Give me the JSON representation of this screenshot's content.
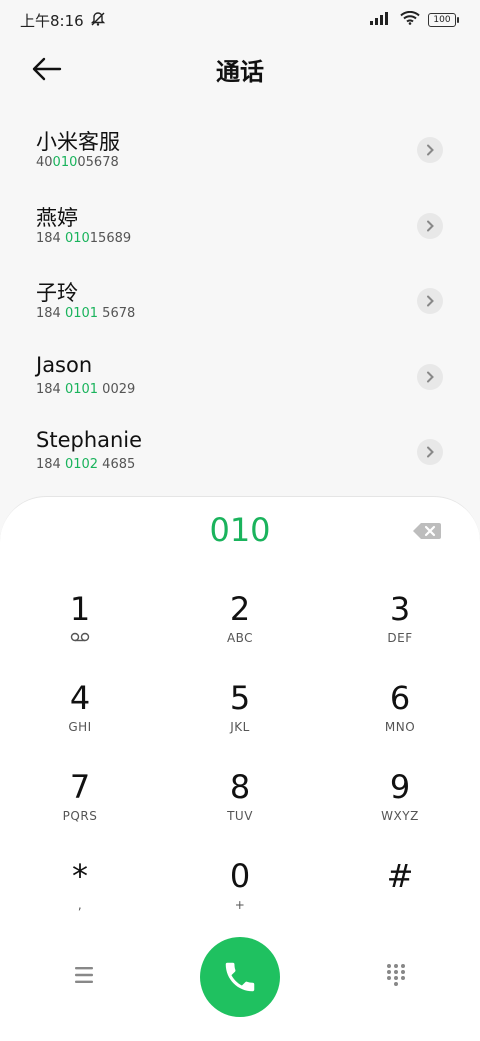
{
  "status": {
    "time": "上午8:16",
    "battery": "100"
  },
  "header": {
    "title": "通话"
  },
  "contacts": [
    {
      "name": "小米客服",
      "num_pre": "40",
      "num_hl": "010",
      "num_post": "05678"
    },
    {
      "name": "燕婷",
      "num_pre": "184 ",
      "num_hl": "010",
      "num_post": "15689"
    },
    {
      "name": "子玲",
      "num_pre": "184 ",
      "num_hl": "0101",
      "num_post": " 5678"
    },
    {
      "name": "Jason",
      "num_pre": "184 ",
      "num_hl": "0101",
      "num_post": " 0029"
    },
    {
      "name": "Stephanie",
      "num_pre": "184 ",
      "num_hl": "0102",
      "num_post": " 4685"
    }
  ],
  "dialer": {
    "typed": "010",
    "keys": [
      {
        "digit": "1",
        "letters": ""
      },
      {
        "digit": "2",
        "letters": "ABC"
      },
      {
        "digit": "3",
        "letters": "DEF"
      },
      {
        "digit": "4",
        "letters": "GHI"
      },
      {
        "digit": "5",
        "letters": "JKL"
      },
      {
        "digit": "6",
        "letters": "MNO"
      },
      {
        "digit": "7",
        "letters": "PQRS"
      },
      {
        "digit": "8",
        "letters": "TUV"
      },
      {
        "digit": "9",
        "letters": "WXYZ"
      },
      {
        "digit": "*",
        "letters": ","
      },
      {
        "digit": "0",
        "letters": "+"
      },
      {
        "digit": "#",
        "letters": ""
      }
    ]
  },
  "colors": {
    "accent": "#1ab35c",
    "call": "#1fc160"
  }
}
